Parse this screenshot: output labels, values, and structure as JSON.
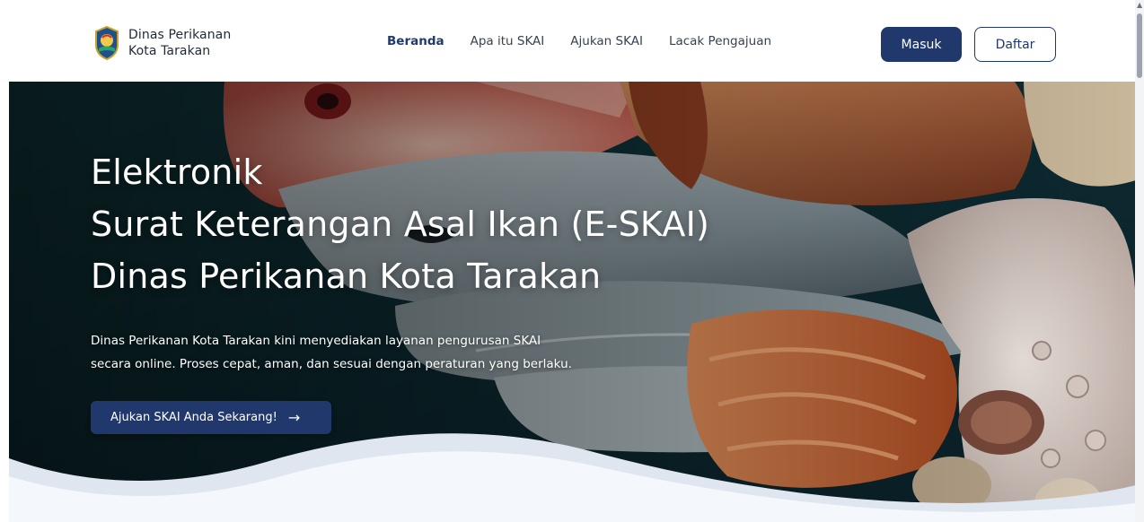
{
  "header": {
    "brand_line1": "Dinas Perikanan",
    "brand_line2": "Kota Tarakan",
    "logo_icon": "city-emblem-icon",
    "nav": [
      {
        "label": "Beranda",
        "active": true
      },
      {
        "label": "Apa itu SKAI",
        "active": false
      },
      {
        "label": "Ajukan SKAI",
        "active": false
      },
      {
        "label": "Lacak Pengajuan",
        "active": false
      }
    ],
    "login_label": "Masuk",
    "register_label": "Daftar"
  },
  "hero": {
    "title_line1": "Elektronik",
    "title_line2": "Surat Keterangan Asal Ikan (E-SKAI)",
    "title_line3": "Dinas Perikanan Kota Tarakan",
    "description_line1": "Dinas Perikanan Kota Tarakan kini menyediakan layanan pengurusan SKAI",
    "description_line2": "secara online. Proses cepat, aman, dan sesuai dengan peraturan yang berlaku.",
    "cta_label": "Ajukan SKAI Anda Sekarang!",
    "cta_icon": "arrow-right-icon",
    "background_image": "seafood-photo"
  },
  "colors": {
    "primary": "#20386b",
    "nav_active": "#1e3a6e",
    "hero_overlay": "#0d2730"
  }
}
